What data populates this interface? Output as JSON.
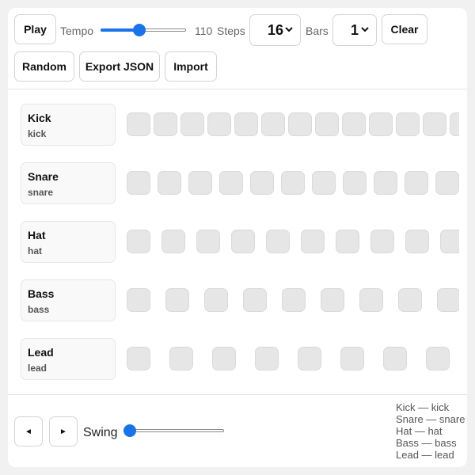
{
  "toolbar": {
    "play_label": "Play",
    "tempo_label": "Tempo",
    "tempo_value": "110",
    "tempo_fraction": 0.45,
    "steps_label": "Steps",
    "steps_value": "16",
    "bars_label": "Bars",
    "bars_value": "1",
    "clear_label": "Clear",
    "random_label": "Random",
    "export_label": "Export JSON",
    "import_label": "Import"
  },
  "tracks": [
    {
      "name": "Kick",
      "id": "kick"
    },
    {
      "name": "Snare",
      "id": "snare"
    },
    {
      "name": "Hat",
      "id": "hat"
    },
    {
      "name": "Bass",
      "id": "bass"
    },
    {
      "name": "Lead",
      "id": "lead"
    }
  ],
  "steps_per_track": 16,
  "footer": {
    "prev_glyph": "◄",
    "next_glyph": "►",
    "swing_label": "Swing",
    "swing_fraction": 0.0
  },
  "legend": [
    {
      "text": "Kick — kick"
    },
    {
      "text": "Snare — snare"
    },
    {
      "text": "Hat — hat"
    },
    {
      "text": "Bass — bass"
    },
    {
      "text": "Lead — lead"
    }
  ],
  "colors": {
    "accent": "#1a73e8",
    "step_off": "#e6e6e6"
  }
}
